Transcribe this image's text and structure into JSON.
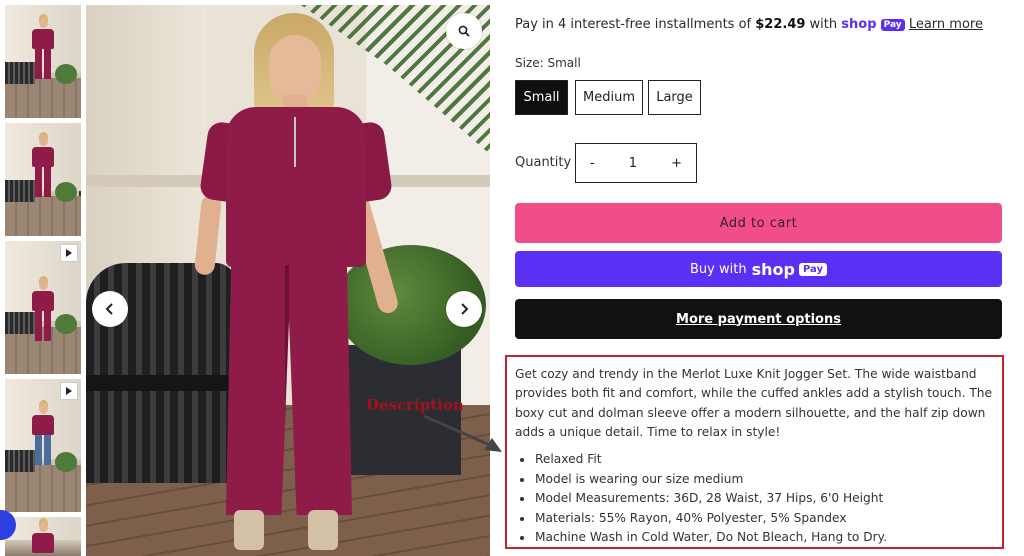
{
  "installments": {
    "prefix": "Pay in 4 interest-free installments of ",
    "amount": "$22.49",
    "middle": " with ",
    "shop_word": "shop",
    "pay_chip": "Pay",
    "learn_more": "Learn more"
  },
  "size": {
    "label": "Size:  Small",
    "options": [
      "Small",
      "Medium",
      "Large"
    ],
    "selected": "Small"
  },
  "quantity": {
    "label": "Quantity",
    "decrement": "-",
    "value": "1",
    "increment": "+"
  },
  "buttons": {
    "add_to_cart": "Add to cart",
    "buy_with": "Buy with",
    "shop_word": "shop",
    "pay_chip": "Pay",
    "more_options": "More payment options"
  },
  "description": {
    "paragraph": "Get cozy and trendy in the Merlot Luxe Knit Jogger Set. The wide waistband provides both fit and comfort, while the cuffed ankles add a stylish touch. The boxy cut and dolman sleeve offer a modern silhouette, and the half zip down adds a unique detail. Time to relax in style!",
    "bullets": [
      "Relaxed Fit",
      "Model is wearing our size medium",
      "Model Measurements: 36D, 28 Waist, 37 Hips, 6'0 Height",
      "Materials: 55% Rayon, 40% Polyester, 5% Spandex",
      "Machine Wash in Cold Water, Do Not Bleach, Hang to Dry."
    ]
  },
  "annotation": {
    "label": "Description"
  },
  "gallery": {
    "icons": {
      "zoom": "magnifier-icon",
      "prev": "chevron-left-icon",
      "next": "chevron-right-icon",
      "play": "play-icon"
    }
  },
  "colors": {
    "add_to_cart": "#f24d8b",
    "shop_pay": "#5a31f4",
    "more_options": "#111111",
    "annotation": "#c4242e",
    "product": "#8e1b48"
  }
}
